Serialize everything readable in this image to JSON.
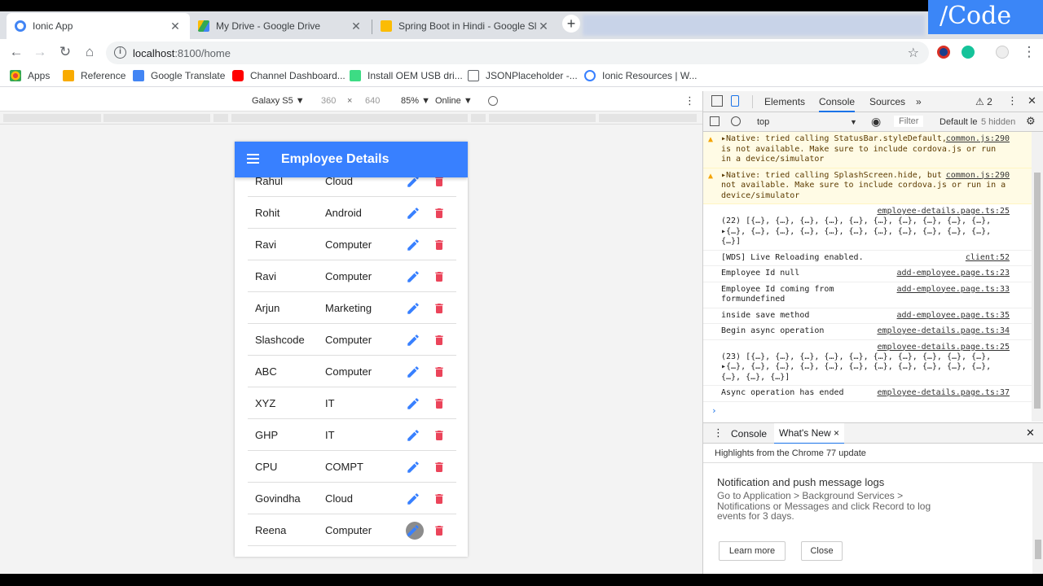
{
  "tabs": [
    {
      "title": "Ionic App",
      "active": true
    },
    {
      "title": "My Drive - Google Drive",
      "active": false
    },
    {
      "title": "Spring Boot in Hindi - Google Sli",
      "active": false
    }
  ],
  "logo_text": "/Code",
  "address": {
    "host": "localhost",
    "path": ":8100/home"
  },
  "bookmarks": [
    {
      "label": "Apps",
      "color": "#ea4335"
    },
    {
      "label": "Reference",
      "color": "#f9ab00"
    },
    {
      "label": "Google Translate",
      "color": "#4285f4"
    },
    {
      "label": "Channel Dashboard...",
      "color": "#ff0000"
    },
    {
      "label": "Install OEM USB dri...",
      "color": "#3ddc84"
    },
    {
      "label": "JSONPlaceholder -...",
      "color": "#5f6368"
    },
    {
      "label": "Ionic Resources | W...",
      "color": "#3880ff"
    }
  ],
  "device_bar": {
    "device": "Galaxy S5 ▼",
    "width": "360",
    "times": "×",
    "height": "640",
    "zoom": "85% ▼",
    "network": "Online ▼"
  },
  "app": {
    "title": "Employee Details",
    "accent": "#3880ff",
    "employees": [
      {
        "name": "Rahul",
        "dept": "Cloud"
      },
      {
        "name": "Rohit",
        "dept": "Android"
      },
      {
        "name": "Ravi",
        "dept": "Computer"
      },
      {
        "name": "Ravi",
        "dept": "Computer"
      },
      {
        "name": "Arjun",
        "dept": "Marketing"
      },
      {
        "name": "Slashcode",
        "dept": "Computer"
      },
      {
        "name": "ABC",
        "dept": "Computer"
      },
      {
        "name": "XYZ",
        "dept": "IT"
      },
      {
        "name": "GHP",
        "dept": "IT"
      },
      {
        "name": "CPU",
        "dept": "COMPT"
      },
      {
        "name": "Govindha",
        "dept": "Cloud"
      },
      {
        "name": "Reena",
        "dept": "Computer"
      }
    ]
  },
  "devtools": {
    "tabs": [
      "Elements",
      "Console",
      "Sources",
      "»"
    ],
    "warning_count": "⚠ 2",
    "context": "top",
    "filter": "Filter",
    "levels": "Default le",
    "hidden": "5 hidden",
    "console_lines": [
      {
        "type": "warn",
        "text": "▸Native: tried calling StatusBar.styleDefault, but Cordova is not available. Make sure to include cordova.js or run in a device/simulator",
        "src": "common.js:290"
      },
      {
        "type": "warn",
        "text": "▸Native: tried calling SplashScreen.hide, but Cordova is not available. Make sure to include cordova.js or run in a device/simulator",
        "src": "common.js:290"
      },
      {
        "type": "log",
        "text": "(22) [{…}, {…}, {…}, {…}, {…}, {…}, {…}, {…}, {…}, {…}, ▸{…}, {…}, {…}, {…}, {…}, {…}, {…}, {…}, {…}, {…}, {…}, {…}]",
        "src": "employee-details.page.ts:25"
      },
      {
        "type": "log",
        "text": "[WDS] Live Reloading enabled.",
        "src": "client:52"
      },
      {
        "type": "log",
        "text": "Employee Id null",
        "src": "add-employee.page.ts:23"
      },
      {
        "type": "log",
        "text": "Employee Id coming from formundefined",
        "src": "add-employee.page.ts:33"
      },
      {
        "type": "log",
        "text": "inside save method",
        "src": "add-employee.page.ts:35"
      },
      {
        "type": "log",
        "text": "Begin async operation",
        "src": "employee-details.page.ts:34"
      },
      {
        "type": "log",
        "text": "(23) [{…}, {…}, {…}, {…}, {…}, {…}, {…}, {…}, {…}, {…}, ▸{…}, {…}, {…}, {…}, {…}, {…}, {…}, {…}, {…}, {…}, {…}, {…}, {…}, {…}]",
        "src": "employee-details.page.ts:25"
      },
      {
        "type": "log",
        "text": "Async operation has ended",
        "src": "employee-details.page.ts:37"
      }
    ],
    "prompt": "›",
    "drawer_tabs": [
      "Console",
      "What's New ×"
    ],
    "whats_new": {
      "header": "Highlights from the Chrome 77 update",
      "title": "Notification and push message logs",
      "body": "Go to Application > Background Services > Notifications or Messages and click Record to log events for 3 days.",
      "learn_more": "Learn more",
      "close": "Close"
    }
  }
}
